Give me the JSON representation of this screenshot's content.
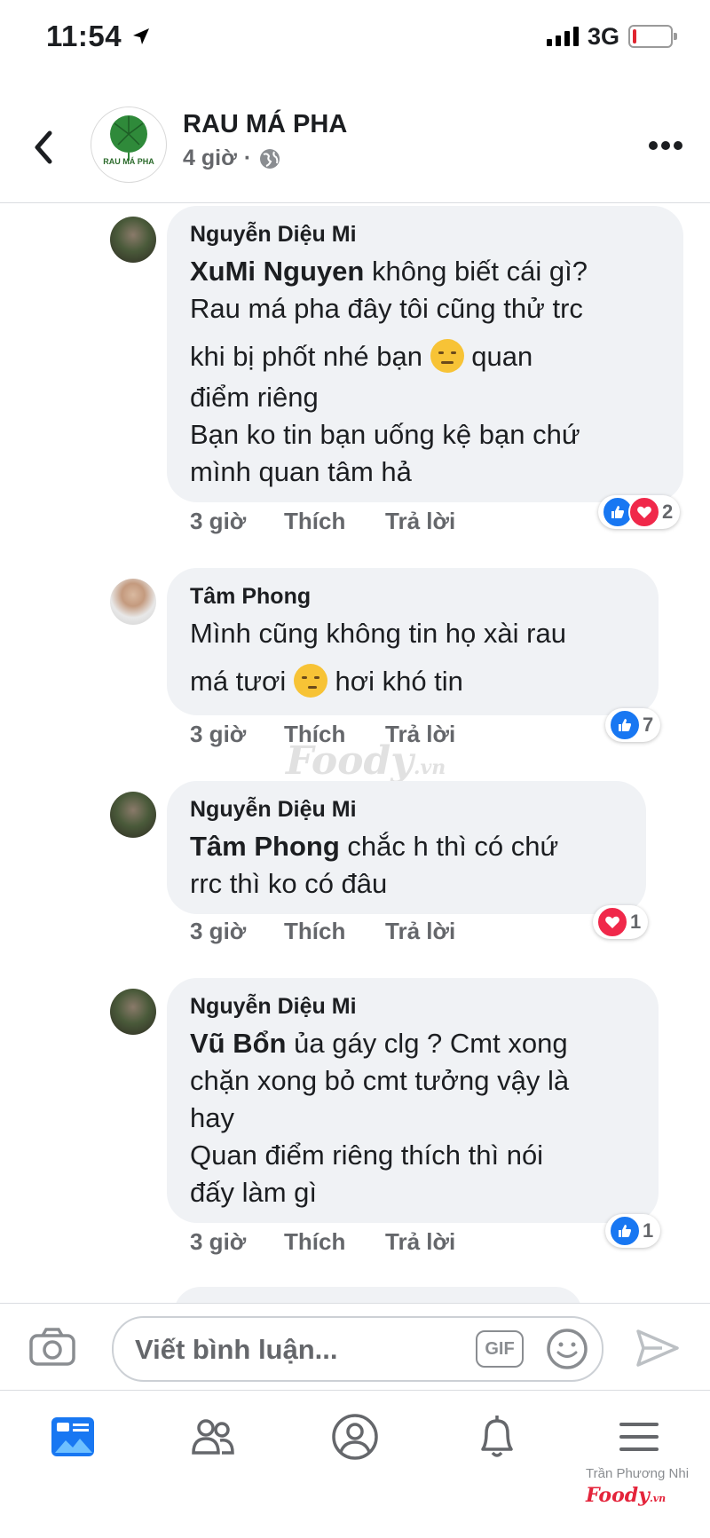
{
  "status_bar": {
    "time": "11:54",
    "network": "3G"
  },
  "header": {
    "page_name": "RAU MÁ PHA",
    "logo_text": "RAU MÁ PHA",
    "time_ago": "4 giờ",
    "separator": "·"
  },
  "comments": [
    {
      "author": "Nguyễn Diệu Mi",
      "lines": [
        {
          "mention": "XuMi Nguyen",
          "text": "  không biết cái gì?"
        },
        {
          "text": "Rau má pha đây tôi cũng thử trc"
        },
        {
          "text": "khi bị phốt nhé bạn",
          "emoji": "smirk",
          "after": " quan"
        },
        {
          "text": "điểm riêng"
        },
        {
          "text": "Bạn ko tin bạn uống kệ bạn chứ"
        },
        {
          "text": "mình quan tâm hả"
        }
      ],
      "time": "3 giờ",
      "like_label": "Thích",
      "reply_label": "Trả lời",
      "reactions": [
        "like",
        "love"
      ],
      "reaction_count": "2"
    },
    {
      "author": "Tâm Phong",
      "lines": [
        {
          "text": "Mình cũng không tin họ xài rau"
        },
        {
          "text": "má tươi",
          "emoji": "thinking",
          "after": " hơi khó tin"
        }
      ],
      "time": "3 giờ",
      "like_label": "Thích",
      "reply_label": "Trả lời",
      "reactions": [
        "like"
      ],
      "reaction_count": "7"
    },
    {
      "author": "Nguyễn Diệu Mi",
      "lines": [
        {
          "mention": "Tâm Phong",
          "text": "  chắc h thì có chứ"
        },
        {
          "text": "rrc thì ko có đâu"
        }
      ],
      "time": "3 giờ",
      "like_label": "Thích",
      "reply_label": "Trả lời",
      "reactions": [
        "love"
      ],
      "reaction_count": "1"
    },
    {
      "author": "Nguyễn Diệu Mi",
      "lines": [
        {
          "mention": "Vũ Bổn",
          "text": "  ủa gáy clg ? Cmt xong"
        },
        {
          "text": "chặn xong bỏ cmt tưởng vậy là"
        },
        {
          "text": "hay"
        },
        {
          "text": "Quan điểm riêng thích thì nói"
        },
        {
          "text": "đấy làm gì"
        }
      ],
      "time": "3 giờ",
      "like_label": "Thích",
      "reply_label": "Trả lời",
      "reactions": [
        "like"
      ],
      "reaction_count": "1"
    }
  ],
  "composer": {
    "placeholder": "Viết bình luận...",
    "gif_label": "GIF"
  },
  "watermark": {
    "brand": "Foody",
    "suffix": ".vn"
  },
  "credit": {
    "name": "Trần Phương Nhi",
    "brand": "Foody",
    "suffix": ".vn"
  },
  "colors": {
    "accent": "#1877f2",
    "love": "#f0284a",
    "bubble": "#f0f2f5",
    "muted": "#65676b"
  },
  "icons": [
    "back-arrow-icon",
    "globe-icon",
    "more-icon",
    "camera-icon",
    "gif-icon",
    "smiley-icon",
    "send-icon",
    "news-feed-icon",
    "friends-icon",
    "profile-icon",
    "notifications-icon",
    "menu-icon"
  ]
}
